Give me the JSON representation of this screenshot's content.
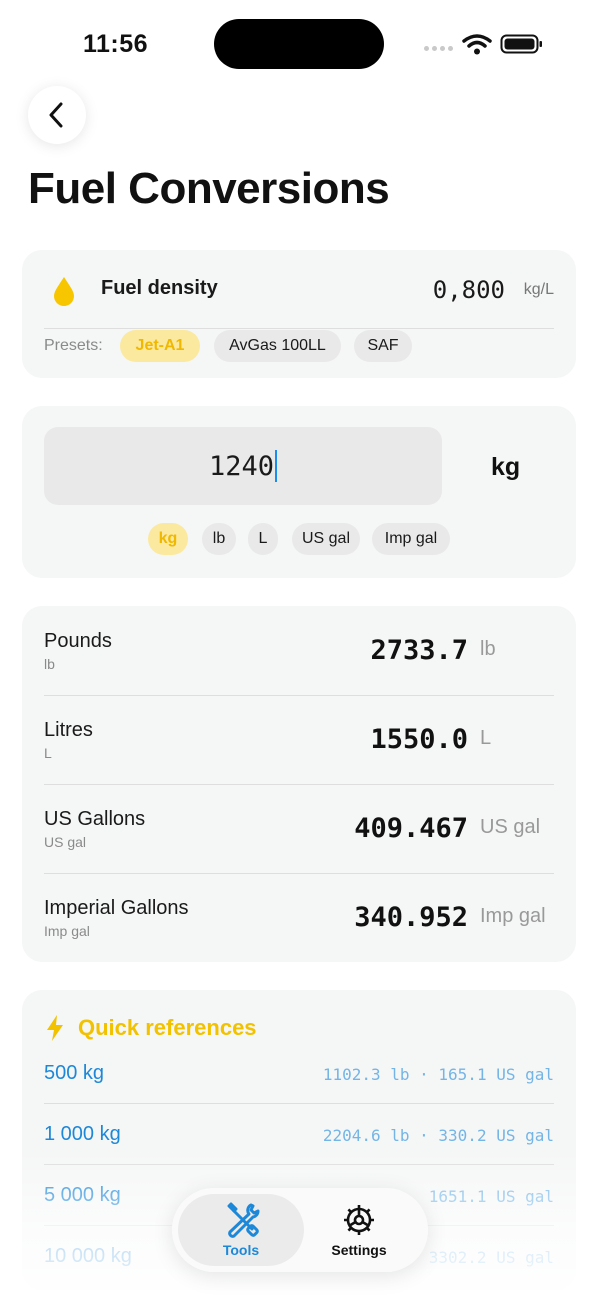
{
  "status_bar": {
    "time": "11:56"
  },
  "header": {
    "title": "Fuel Conversions"
  },
  "density": {
    "label": "Fuel density",
    "value": "0,800",
    "unit": "kg/L",
    "presets_label": "Presets:",
    "presets": [
      "Jet-A1",
      "AvGas 100LL",
      "SAF"
    ],
    "selected_preset": "Jet-A1"
  },
  "input": {
    "value": "1240",
    "unit": "kg",
    "units": [
      "kg",
      "lb",
      "L",
      "US gal",
      "Imp gal"
    ],
    "selected_unit": "kg"
  },
  "results": [
    {
      "name": "Pounds",
      "sub": "lb",
      "value": "2733.7",
      "unit": "lb"
    },
    {
      "name": "Litres",
      "sub": "L",
      "value": "1550.0",
      "unit": "L"
    },
    {
      "name": "US Gallons",
      "sub": "US gal",
      "value": "409.467",
      "unit": "US gal"
    },
    {
      "name": "Imperial Gallons",
      "sub": "Imp gal",
      "value": "340.952",
      "unit": "Imp gal"
    }
  ],
  "quick_refs": {
    "title": "Quick references",
    "rows": [
      {
        "left": "500 kg",
        "right": "1102.3 lb · 165.1 US gal"
      },
      {
        "left": "1 000 kg",
        "right": "2204.6 lb · 330.2 US gal"
      },
      {
        "left": "5 000 kg",
        "right": "1651.1 US gal"
      },
      {
        "left": "10 000 kg",
        "right": "3302.2 US gal"
      }
    ]
  },
  "tabs": [
    {
      "label": "Tools",
      "icon": "tools-icon",
      "active": true
    },
    {
      "label": "Settings",
      "icon": "gear-icon",
      "active": false
    }
  ],
  "colors": {
    "accent_yellow": "#F2C200",
    "chip_active_bg": "#FBE9A0",
    "accent_blue": "#1E88D8"
  }
}
